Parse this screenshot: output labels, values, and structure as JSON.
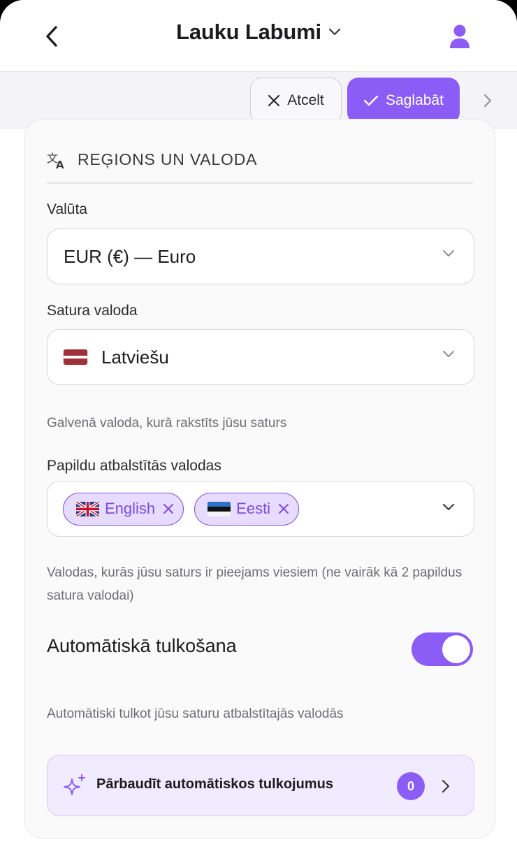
{
  "header": {
    "title": "Lauku Labumi",
    "back_icon": "chevron-left-icon",
    "user_icon": "user-icon"
  },
  "toolbar": {
    "cancel_label": "Atcelt",
    "save_label": "Saglabāt"
  },
  "section": {
    "title": "REĢIONS UN VALODA",
    "icon": "translate-icon"
  },
  "currency": {
    "label": "Valūta",
    "value": "EUR (€) — Euro"
  },
  "content_language": {
    "label": "Satura valoda",
    "value": "Latviešu",
    "helper": "Galvenā valoda, kurā rakstīts jūsu saturs"
  },
  "additional_languages": {
    "label": "Papildu atbalstītās valodas",
    "chips": [
      {
        "label": "English"
      },
      {
        "label": "Eesti"
      }
    ],
    "helper": "Valodas, kurās jūsu saturs ir pieejams viesiem (ne vairāk kā 2 papildus satura valodai)"
  },
  "auto_translate": {
    "label": "Automātiskā tulkošana",
    "enabled": true,
    "helper": "Automātiski tulkot jūsu saturu atbalstītajās valodās"
  },
  "review": {
    "label": "Pārbaudīt automātiskos tulkojumus",
    "count": "0",
    "icon": "sparkles-icon"
  },
  "colors": {
    "accent": "#8b5cf6",
    "chip_bg": "#e7dcff",
    "review_bg": "#f1ebff"
  }
}
